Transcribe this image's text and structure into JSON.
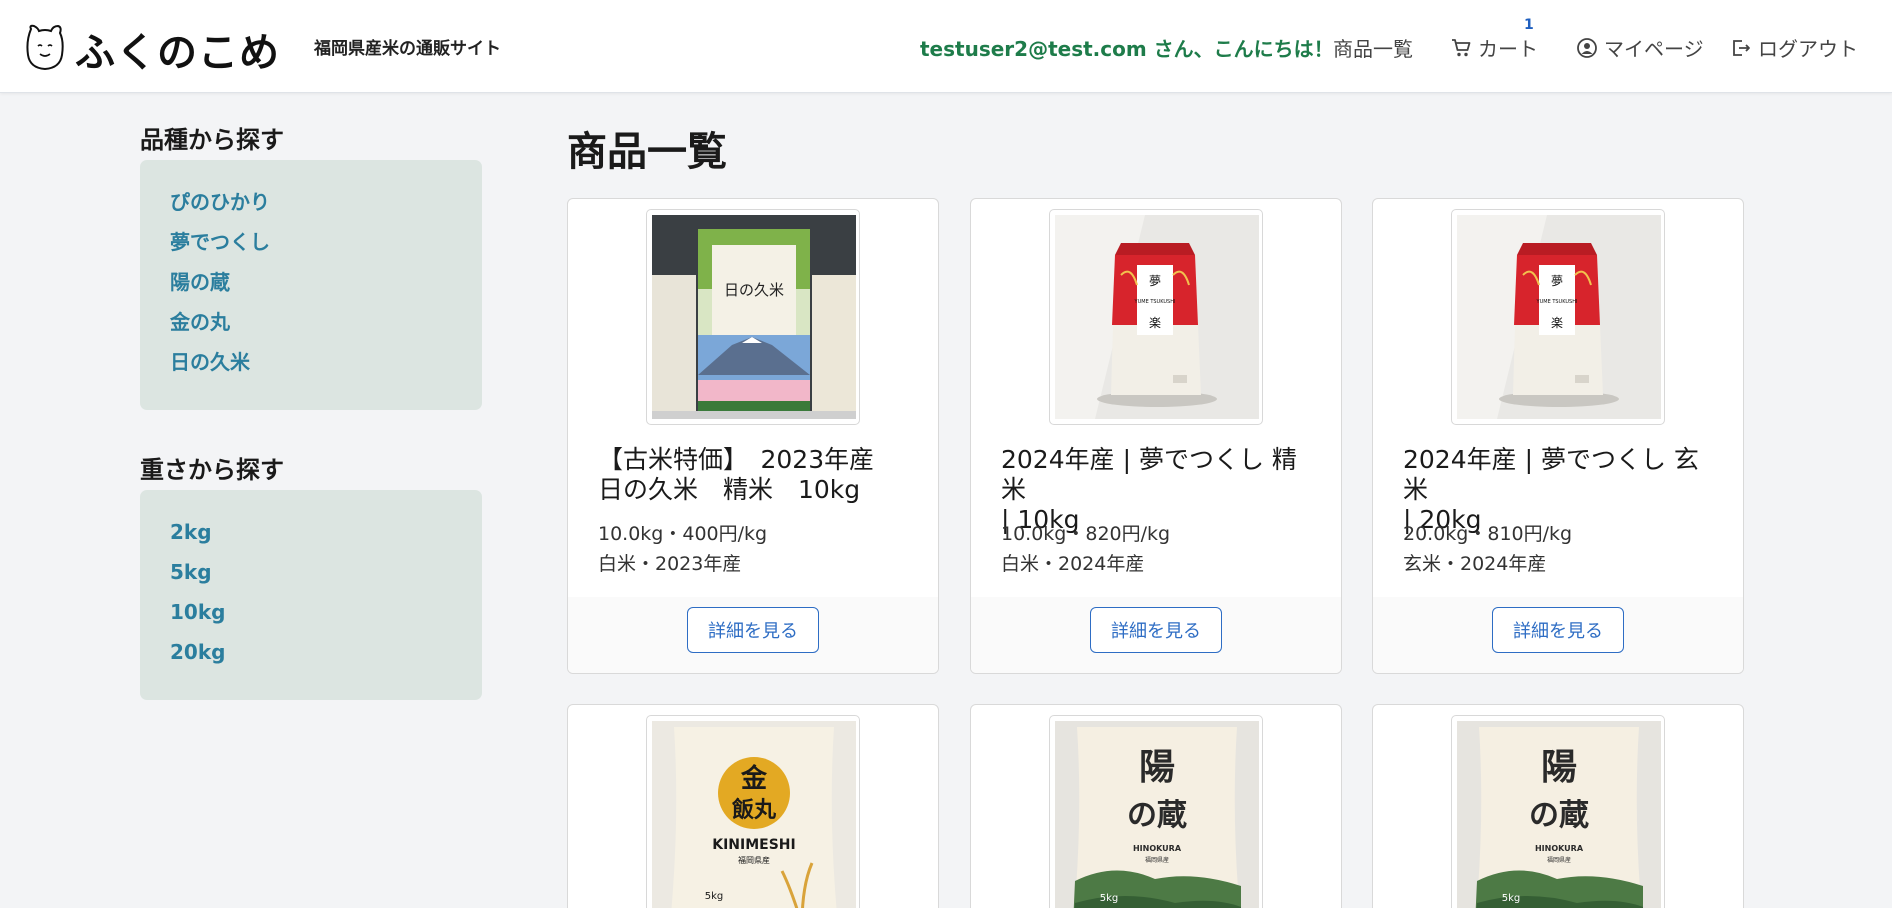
{
  "header": {
    "logo_text": "ふくのこめ",
    "tagline": "福岡県産米の通販サイト",
    "greeting": "testuser2@test.com さん、こんにちは！",
    "nav": {
      "products": "商品一覧",
      "cart": "カート",
      "cart_count": "1",
      "mypage": "マイページ",
      "logout": "ログアウト"
    }
  },
  "sidebar": {
    "variety": {
      "heading": "品種から探す",
      "items": [
        "ぴのひかり",
        "夢でつくし",
        "陽の蔵",
        "金の丸",
        "日の久米"
      ]
    },
    "weight": {
      "heading": "重さから探す",
      "items": [
        "2kg",
        "5kg",
        "10kg",
        "20kg"
      ]
    }
  },
  "main": {
    "title": "商品一覧",
    "button_label": "詳細を見る",
    "products": [
      {
        "title_line1": "【古米特価】　2023年産",
        "title_line2": "日の久米　精米　10kg",
        "spec": "10.0kg・400円/kg",
        "type": "白米・2023年産",
        "image": "hinokume-bag-image"
      },
      {
        "title_line1": "2024年産 | 夢でつくし 精米",
        "title_line2": "| 10kg",
        "spec": "10.0kg・820円/kg",
        "type": "白米・2024年産",
        "image": "yumedetsukushi-bag-image"
      },
      {
        "title_line1": "2024年産 | 夢でつくし 玄米",
        "title_line2": "| 20kg",
        "spec": "20.0kg・810円/kg",
        "type": "玄米・2024年産",
        "image": "yumedetsukushi-bag-image"
      },
      {
        "image": "kinnomaru-bag-image",
        "bag_label": "金",
        "bag_label2": "飯丸",
        "bag_text": "KINIMESHI",
        "bag_sub": "福岡県産",
        "bag_weight": "5kg"
      },
      {
        "image": "hinokura-bag-image",
        "bag_label": "陽",
        "bag_label2": "の蔵",
        "bag_text": "HINOKURA",
        "bag_sub": "福岡県産",
        "bag_weight": "5kg"
      },
      {
        "image": "hinokura-bag-image",
        "bag_label": "陽",
        "bag_label2": "の蔵",
        "bag_text": "HINOKURA",
        "bag_sub": "福岡県産",
        "bag_weight": "5kg"
      }
    ]
  },
  "colors": {
    "greeting": "#1e7c4a",
    "sidebar_link": "#2b7e9e",
    "sidebar_box": "#dce5e1",
    "button": "#2e6dc4",
    "badge": "#1f5fbf"
  },
  "bag_art": {
    "hinokume_label": "日の久米",
    "yume_label": "夢",
    "yume_label2": "楽",
    "yume_vertical": "YUME TSUKUSHI"
  }
}
